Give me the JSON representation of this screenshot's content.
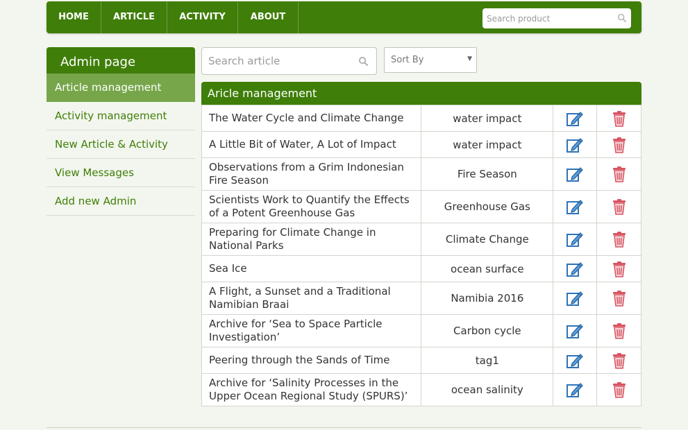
{
  "nav": {
    "items": [
      "HOME",
      "ARTICLE",
      "ACTIVITY",
      "ABOUT"
    ],
    "search_placeholder": "Search product"
  },
  "sidebar": {
    "title": "Admin page",
    "items": [
      {
        "label": "Article management",
        "active": true
      },
      {
        "label": "Activity management",
        "active": false
      },
      {
        "label": "New Article & Activity",
        "active": false
      },
      {
        "label": "View Messages",
        "active": false
      },
      {
        "label": "Add new Admin",
        "active": false
      }
    ]
  },
  "filters": {
    "search_placeholder": "Search article",
    "sort_label": "Sort By"
  },
  "panel": {
    "title": "Aricle management",
    "rows": [
      {
        "title": "The Water Cycle and Climate Change",
        "tag": "water impact"
      },
      {
        "title": "A Little Bit of Water, A Lot of Impact",
        "tag": "water impact"
      },
      {
        "title": "Observations from a Grim Indonesian Fire Season",
        "tag": "Fire Season"
      },
      {
        "title": "Scientists Work to Quantify the Effects of a Potent Greenhouse Gas",
        "tag": "Greenhouse Gas"
      },
      {
        "title": "Preparing for Climate Change in National Parks",
        "tag": "Climate Change"
      },
      {
        "title": "Sea Ice",
        "tag": "ocean surface"
      },
      {
        "title": "A Flight, a Sunset and a Traditional Namibian Braai",
        "tag": "Namibia 2016"
      },
      {
        "title": "Archive for ‘Sea to Space Particle Investigation’",
        "tag": "Carbon cycle"
      },
      {
        "title": "Peering through the Sands of Time",
        "tag": "tag1"
      },
      {
        "title": "Archive for ‘Salinity Processes in the Upper Ocean Regional Study (SPURS)’",
        "tag": "ocean salinity"
      }
    ]
  },
  "icons": {
    "edit": "edit-icon",
    "delete": "trash-icon",
    "search": "search-icon"
  },
  "colors": {
    "brand_green": "#3f7e09",
    "active_green": "#77a64a",
    "edit_blue": "#2f73b8",
    "delete_red": "#d95562"
  }
}
